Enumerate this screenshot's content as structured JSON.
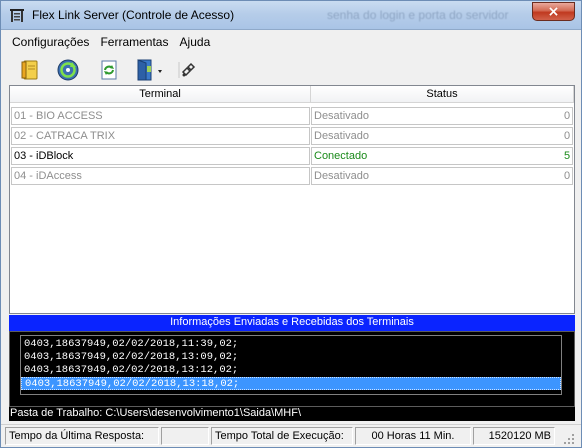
{
  "window": {
    "title": "Flex Link Server (Controle de Acesso)",
    "title_ghost_text": "senha do login e porta do servidor",
    "close_symbol": "×",
    "icon": "gate-icon"
  },
  "menu": {
    "items": [
      {
        "label": "Configurações"
      },
      {
        "label": "Ferramentas"
      },
      {
        "label": "Ajuda"
      }
    ]
  },
  "toolbar": {
    "buttons": [
      {
        "icon": "notebook-icon"
      },
      {
        "icon": "sync-circle-icon"
      },
      {
        "icon": "refresh-page-icon"
      },
      {
        "icon": "exit-door-icon"
      },
      {
        "icon": "network-link-icon"
      }
    ]
  },
  "grid": {
    "columns": [
      "Terminal",
      "Status"
    ],
    "rows": [
      {
        "terminal": "01 - BIO ACCESS",
        "status": "Desativado",
        "count": "0",
        "state": "disabled"
      },
      {
        "terminal": "02 - CATRACA TRIX",
        "status": "Desativado",
        "count": "0",
        "state": "disabled"
      },
      {
        "terminal": "03 - iDBlock",
        "status": "Conectado",
        "count": "5",
        "state": "active"
      },
      {
        "terminal": "04 - iDAccess",
        "status": "Desativado",
        "count": "0",
        "state": "disabled"
      }
    ]
  },
  "info": {
    "header": "Informações Enviadas e Recebidas dos Terminais",
    "log": [
      "0403,18637949,02/02/2018,11:39,02;",
      "0403,18637949,02/02/2018,13:09,02;",
      "0403,18637949,02/02/2018,13:12,02;",
      "0403,18637949,02/02/2018,13:18,02;"
    ],
    "selected_index": 3,
    "work_folder": "Pasta de Trabalho: C:\\Users\\desenvolvimento1\\Saida\\MHF\\"
  },
  "statusbar": {
    "last_response_label": "Tempo da Última Resposta:",
    "last_response_value": "",
    "total_time_label": "Tempo Total de Execução:",
    "total_time_value": "00 Horas 11 Min.",
    "memory": "1520120 MB"
  },
  "colors": {
    "info_header_bg": "#0a24ff",
    "connected_text": "#1a8a1a",
    "selected_log_bg": "#3c95ff"
  }
}
